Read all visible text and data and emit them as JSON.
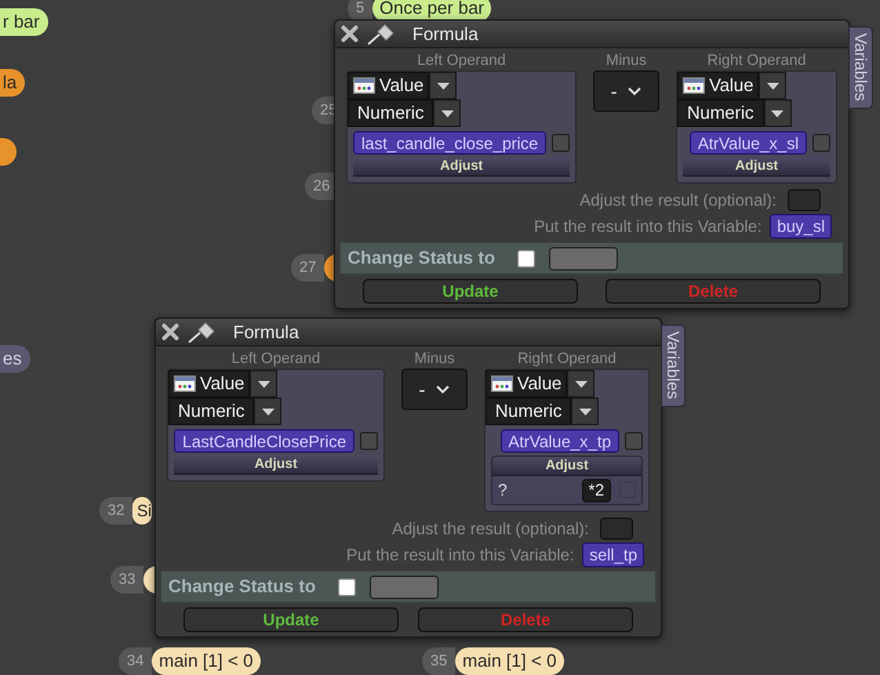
{
  "nodes": [
    {
      "label": "r bar",
      "color": "#c8ec8c"
    },
    {
      "label": "la",
      "color": "#e8922c"
    },
    {
      "color": "#e8922c"
    },
    {
      "label": "es",
      "color": "#5a5870"
    },
    {
      "number": "5",
      "label": "Once per bar",
      "color": "#c8ec8c"
    },
    {
      "number": "25"
    },
    {
      "number": "26"
    },
    {
      "number": "27",
      "color": "#e8922c"
    },
    {
      "number": "32",
      "label": "Si",
      "color": "#f5deb0"
    },
    {
      "number": "33",
      "color": "#f5deb0"
    },
    {
      "number": "34",
      "label": "main [1] < 0",
      "color": "#f5deb0"
    },
    {
      "number": "35",
      "label": "main [1] < 0",
      "color": "#f5deb0"
    }
  ],
  "windows": [
    {
      "title": "Formula",
      "side_tab": "Variables",
      "left": {
        "label": "Left Operand",
        "type": "Value",
        "format": "Numeric",
        "variable": "last_candle_close_price",
        "checked": false,
        "adjust": {
          "label": "Adjust",
          "expanded": false
        }
      },
      "operator": {
        "label": "Minus",
        "value": "-"
      },
      "right": {
        "label": "Right Operand",
        "type": "Value",
        "format": "Numeric",
        "variable": "AtrValue_x_sl",
        "checked": false,
        "adjust": {
          "label": "Adjust",
          "expanded": false
        }
      },
      "adjust_result": {
        "label": "Adjust the result (optional):"
      },
      "result": {
        "label": "Put the result into this Variable:",
        "variable": "buy_sl"
      },
      "change_status": {
        "label": "Change Status to",
        "checked": false
      },
      "buttons": [
        {
          "label": "Update",
          "kind": "update"
        },
        {
          "label": "Delete",
          "kind": "delete"
        }
      ]
    },
    {
      "title": "Formula",
      "side_tab": "Variables",
      "left": {
        "label": "Left Operand",
        "type": "Value",
        "format": "Numeric",
        "variable": "LastCandleClosePrice",
        "checked": false,
        "adjust": {
          "label": "Adjust",
          "expanded": false
        }
      },
      "operator": {
        "label": "Minus",
        "value": "-"
      },
      "right": {
        "label": "Right Operand",
        "type": "Value",
        "format": "Numeric",
        "variable": "AtrValue_x_tp",
        "checked": false,
        "adjust": {
          "label": "Adjust",
          "expanded": true,
          "field_label": "?",
          "value": "*2"
        }
      },
      "adjust_result": {
        "label": "Adjust the result (optional):"
      },
      "result": {
        "label": "Put the result into this Variable:",
        "variable": "sell_tp"
      },
      "change_status": {
        "label": "Change Status to",
        "checked": false
      },
      "buttons": [
        {
          "label": "Update",
          "kind": "update"
        },
        {
          "label": "Delete",
          "kind": "delete"
        }
      ]
    }
  ]
}
